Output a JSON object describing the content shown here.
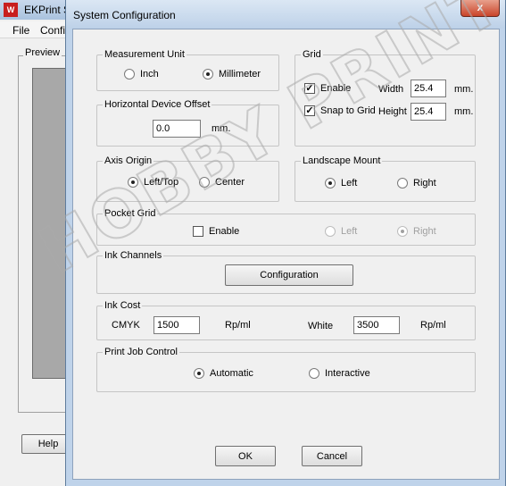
{
  "background_app": {
    "title": "EKPrint St",
    "logo_text": "W",
    "menu": [
      "File",
      "Config"
    ],
    "preview_label": "Preview",
    "help_label": "Help"
  },
  "dialog": {
    "title": "System Configuration",
    "close_glyph": "x"
  },
  "measurement_unit": {
    "legend": "Measurement Unit",
    "options": [
      "Inch",
      "Millimeter"
    ],
    "selected": "Millimeter"
  },
  "horizontal_offset": {
    "legend": "Horizontal Device Offset",
    "value": "0.0",
    "unit": "mm."
  },
  "grid": {
    "legend": "Grid",
    "enable_label": "Enable",
    "enable_checked": true,
    "snap_label": "Snap to Grid",
    "snap_checked": true,
    "width_label": "Width",
    "width_value": "25.4",
    "height_label": "Height",
    "height_value": "25.4",
    "unit": "mm."
  },
  "axis_origin": {
    "legend": "Axis Origin",
    "options": [
      "Left/Top",
      "Center"
    ],
    "selected": "Left/Top"
  },
  "landscape_mount": {
    "legend": "Landscape Mount",
    "options": [
      "Left",
      "Right"
    ],
    "selected": "Left"
  },
  "pocket_grid": {
    "legend": "Pocket Grid",
    "enable_label": "Enable",
    "enable_checked": false,
    "options": [
      "Left",
      "Right"
    ],
    "selected": "Right"
  },
  "ink_channels": {
    "legend": "Ink Channels",
    "button_label": "Configuration"
  },
  "ink_cost": {
    "legend": "Ink Cost",
    "cmyk_label": "CMYK",
    "cmyk_value": "1500",
    "cmyk_unit": "Rp/ml",
    "white_label": "White",
    "white_value": "3500",
    "white_unit": "Rp/ml"
  },
  "print_job_control": {
    "legend": "Print Job Control",
    "options": [
      "Automatic",
      "Interactive"
    ],
    "selected": "Automatic"
  },
  "buttons": {
    "ok": "OK",
    "cancel": "Cancel"
  },
  "watermark": "HOBBY PRINT"
}
